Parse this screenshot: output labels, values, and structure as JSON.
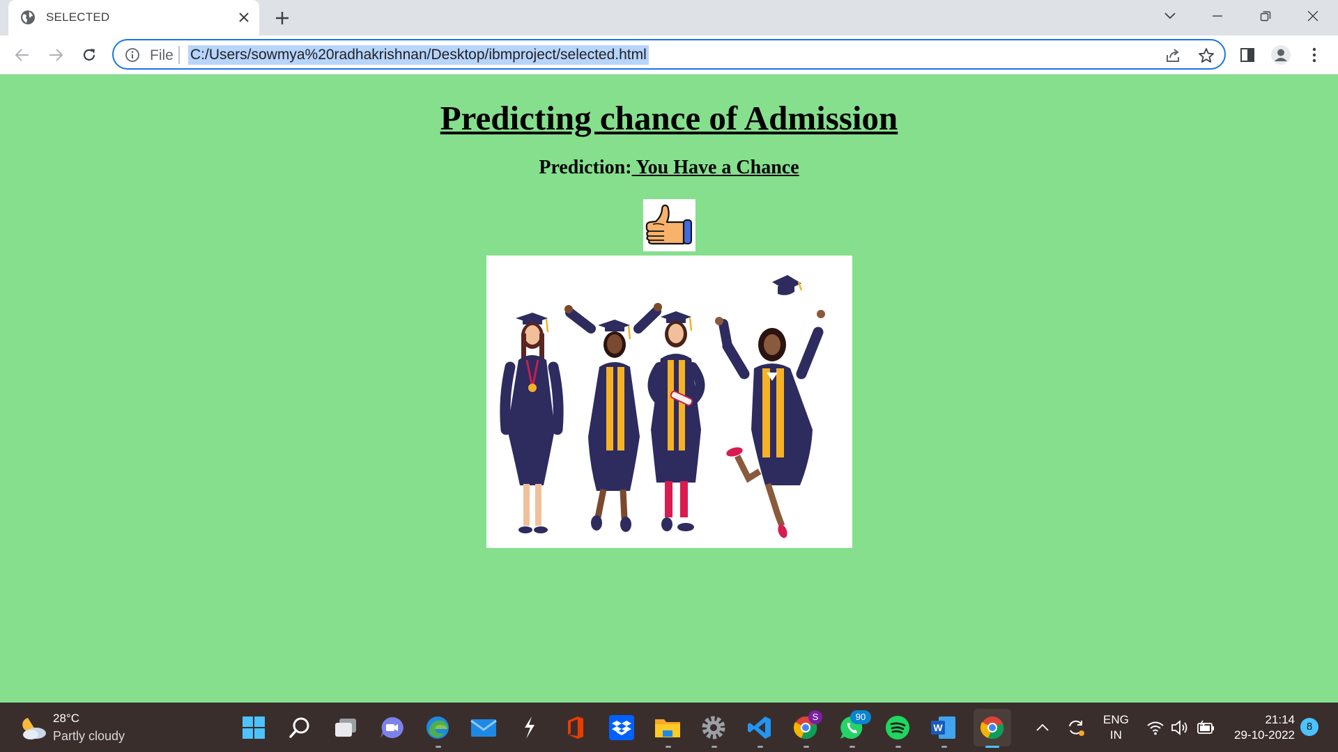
{
  "browser": {
    "tab_title": "SELECTED",
    "address_scheme_label": "File",
    "address_url": "C:/Users/sowmya%20radhakrishnan/Desktop/ibmproject/selected.html"
  },
  "page": {
    "heading": "Predicting chance of Admission",
    "prediction_label": "Prediction:",
    "prediction_value": " You Have a Chance"
  },
  "taskbar": {
    "weather_temp": "28°C",
    "weather_condition": "Partly cloudy",
    "whatsapp_badge": "90",
    "chrome_profile_badge": "S",
    "lang_line1": "ENG",
    "lang_line2": "IN",
    "time": "21:14",
    "date": "29-10-2022",
    "notification_count": "8",
    "icons": [
      "start-icon",
      "search-icon",
      "task-view-icon",
      "teams-chat-icon",
      "edge-icon",
      "mail-icon",
      "sketchbook-icon",
      "office-icon",
      "dropbox-icon",
      "file-explorer-icon",
      "settings-icon",
      "vscode-icon",
      "chrome-profile-icon",
      "whatsapp-icon",
      "spotify-icon",
      "word-icon",
      "chrome-icon"
    ]
  },
  "colors": {
    "page_background": "#86df8d",
    "url_highlight": "#b7d4fb",
    "omnibox_border": "#1a73e8",
    "taskbar": "#3a2e2c",
    "gown": "#2e2b5f",
    "stole": "#f5b226"
  }
}
